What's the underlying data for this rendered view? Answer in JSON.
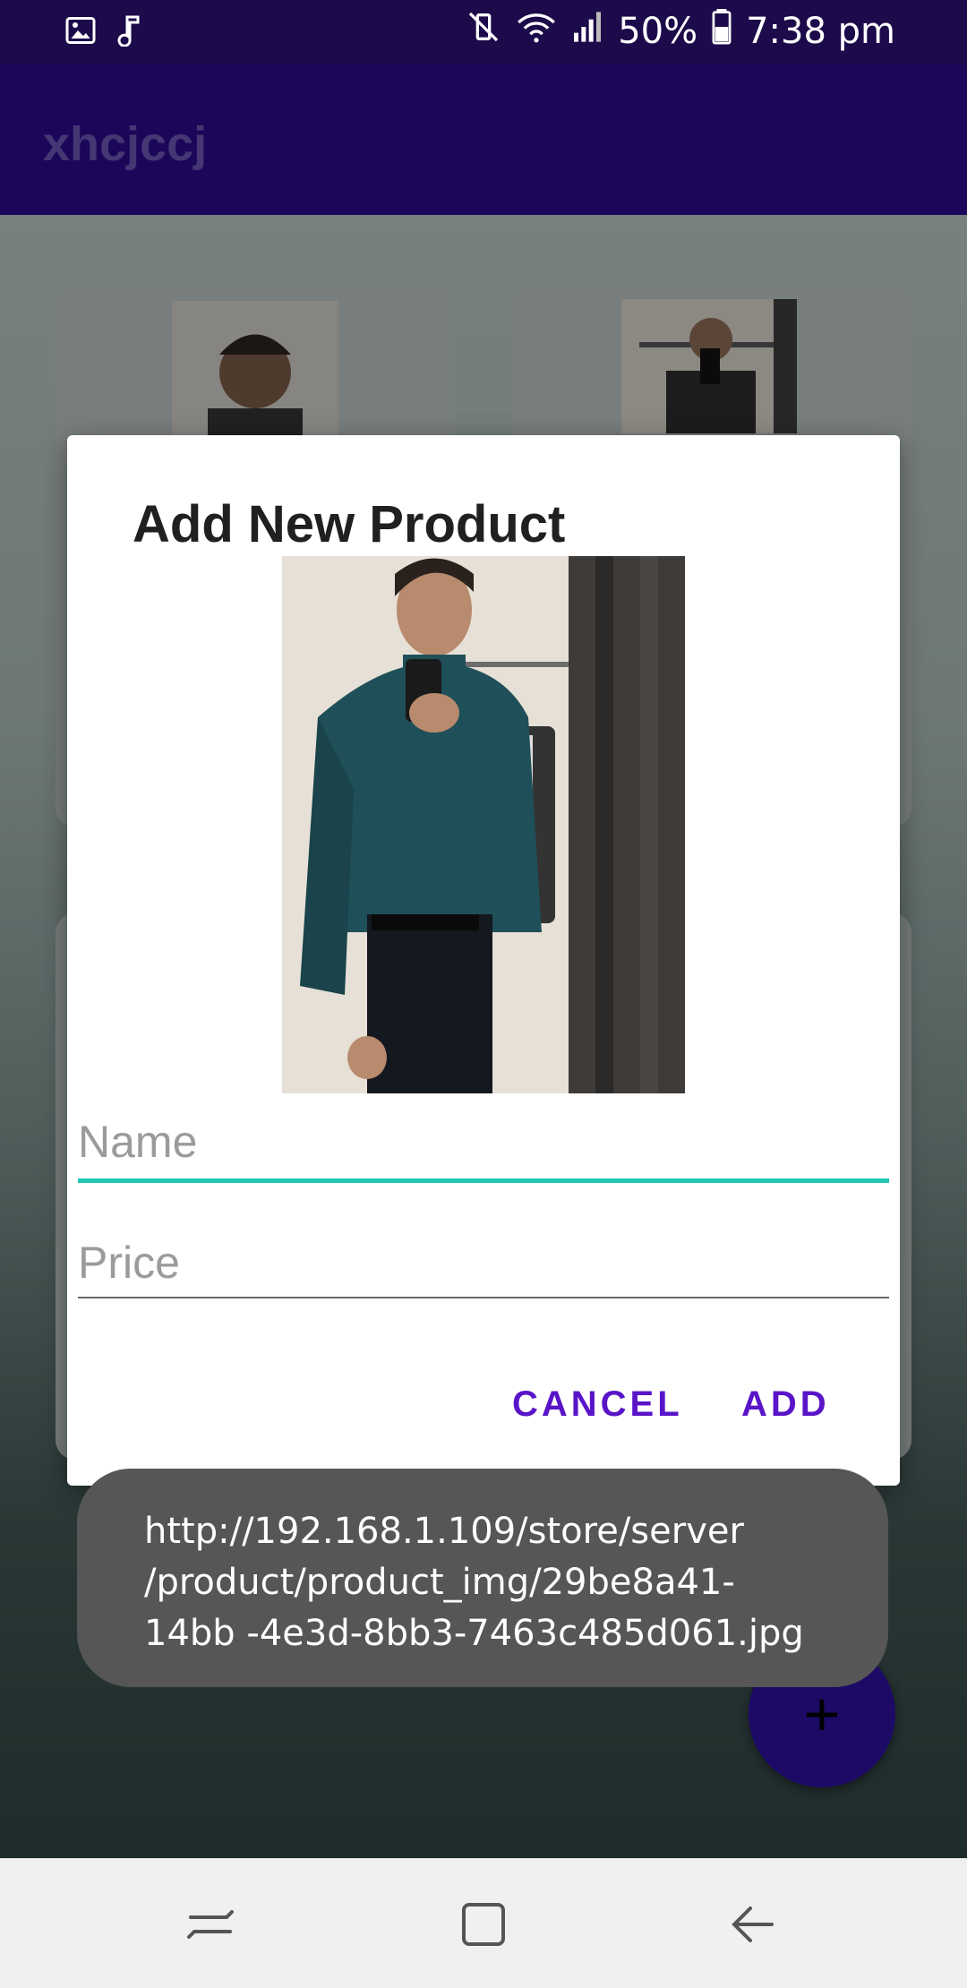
{
  "status_bar": {
    "battery": "50%",
    "time": "7:38 pm",
    "icons": [
      "image-icon",
      "music-note-icon",
      "mute-vibrate-icon",
      "wifi-icon",
      "signal-icon",
      "battery-icon"
    ]
  },
  "app_bar": {
    "title": "xhcjccj"
  },
  "dialog": {
    "title": "Add New Product",
    "name_placeholder": "Name",
    "price_placeholder": "Price",
    "cancel_label": "CANCEL",
    "add_label": "ADD"
  },
  "toast": {
    "message": "http://192.168.1.109/store/server /product/product_img/29be8a41-14bb -4e3d-8bb3-7463c485d061.jpg"
  },
  "fab": {
    "label": "+"
  },
  "nav_bar": {
    "icons": [
      "recents-icon",
      "home-icon",
      "back-icon"
    ]
  },
  "colors": {
    "status_bar": "#1c0a4a",
    "app_bar": "#2c0a8a",
    "accent": "#5a14c8",
    "focus_underline": "#22c7b6",
    "fab": "#1d0a66"
  }
}
